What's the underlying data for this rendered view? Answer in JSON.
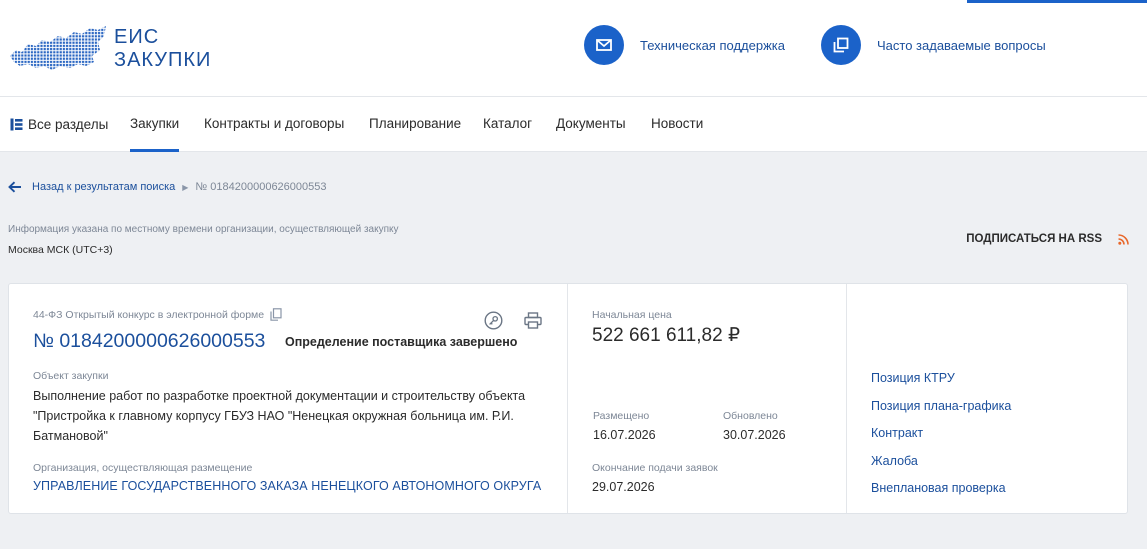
{
  "header": {
    "logo_line1": "ЕИС",
    "logo_line2": "ЗАКУПКИ",
    "support_label": "Техническая поддержка",
    "faq_label": "Часто задаваемые вопросы"
  },
  "nav": {
    "items": [
      {
        "label": "Все разделы"
      },
      {
        "label": "Закупки"
      },
      {
        "label": "Контракты и договоры"
      },
      {
        "label": "Планирование"
      },
      {
        "label": "Каталог"
      },
      {
        "label": "Документы"
      },
      {
        "label": "Новости"
      }
    ],
    "active": "Закупки"
  },
  "breadcrumb": {
    "back_label": "Назад к результатам поиска",
    "current": "№ 0184200000626000553"
  },
  "timezone": {
    "note": "Информация указана по местному времени организации, осуществляющей закупку",
    "value": "Москва МСК (UTC+3)"
  },
  "rss_label": "ПОДПИСАТЬСЯ НА RSS",
  "purchase": {
    "law_type": "44-ФЗ Открытый конкурс в электронной форме",
    "number": "№ 0184200000626000553",
    "status": "Определение поставщика завершено",
    "object_label": "Объект закупки",
    "object_text": "Выполнение работ по разработке проектной документации и строительству объекта \"Пристройка к главному корпусу ГБУЗ НАО \"Ненецкая окружная больница им. Р.И. Батмановой\"",
    "org_label": "Организация, осуществляющая размещение",
    "org_name": "УПРАВЛЕНИЕ ГОСУДАРСТВЕННОГО ЗАКАЗА НЕНЕЦКОГО АВТОНОМНОГО ОКРУГА",
    "price_label": "Начальная цена",
    "price_value": "522 661 611,82 ₽",
    "placed_label": "Размещено",
    "placed_date": "16.07.2026",
    "updated_label": "Обновлено",
    "updated_date": "30.07.2026",
    "deadline_label": "Окончание подачи заявок",
    "deadline_date": "29.07.2026"
  },
  "side_links": [
    {
      "label": "Позиция КТРУ"
    },
    {
      "label": "Позиция плана-графика"
    },
    {
      "label": "Контракт"
    },
    {
      "label": "Жалоба"
    },
    {
      "label": "Внеплановая проверка"
    }
  ],
  "colors": {
    "accent": "#1b62c9",
    "link": "#1b4f9c",
    "background": "#eef0f3",
    "rss": "#e8672a"
  },
  "icons": {
    "support": "envelope-icon",
    "faq": "windows-icon",
    "nav_all": "sections-icon",
    "back": "arrow-left-icon",
    "copy": "copy-icon",
    "key": "key-icon",
    "print": "printer-icon",
    "rss": "rss-icon"
  }
}
